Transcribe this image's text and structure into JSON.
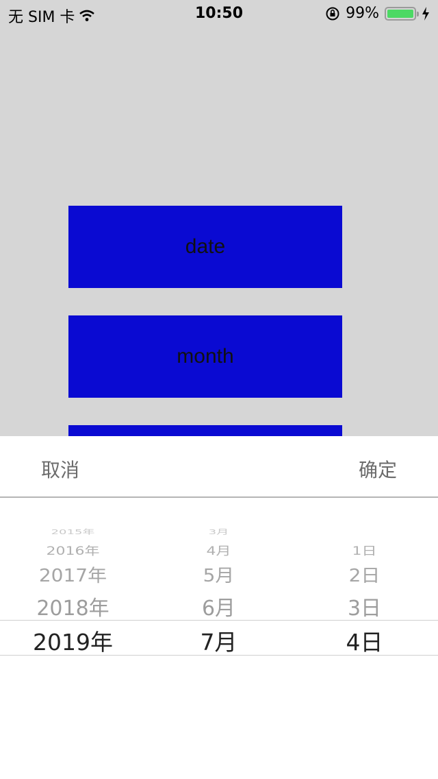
{
  "status_bar": {
    "carrier": "无 SIM 卡",
    "time": "10:50",
    "battery_percent": "99%",
    "battery_level": 0.99
  },
  "buttons": [
    "date",
    "month",
    ""
  ],
  "toolbar": {
    "cancel_label": "取消",
    "confirm_label": "确定"
  },
  "picker": {
    "years": [
      "2015年",
      "2016年",
      "2017年",
      "2018年",
      "2019年"
    ],
    "months": [
      "3月",
      "4月",
      "5月",
      "6月",
      "7月"
    ],
    "days": [
      "",
      "1日",
      "2日",
      "3日",
      "4日"
    ],
    "selected": {
      "year": "2019年",
      "month": "7月",
      "day": "4日"
    }
  }
}
